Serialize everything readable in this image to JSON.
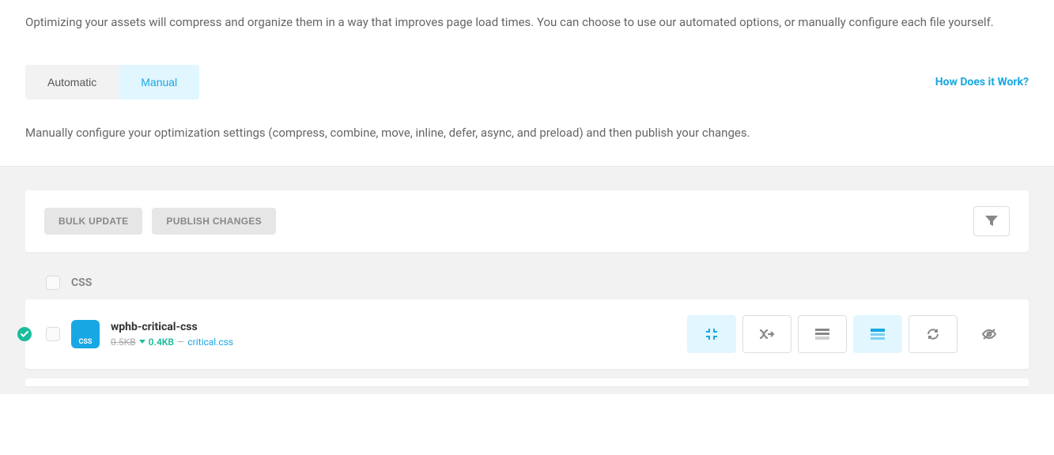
{
  "intro": "Optimizing your assets will compress and organize them in a way that improves page load times. You can choose to use our automated options, or manually configure each file yourself.",
  "tabs": {
    "automatic": "Automatic",
    "manual": "Manual"
  },
  "help_link": "How Does it Work?",
  "sub_desc": "Manually configure your optimization settings (compress, combine, move, inline, defer, async, and preload) and then publish your changes.",
  "buttons": {
    "bulk_update": "BULK UPDATE",
    "publish": "PUBLISH CHANGES"
  },
  "group": {
    "label": "CSS"
  },
  "asset": {
    "name": "wphb-critical-css",
    "badge": "CSS",
    "size_orig": "0.5KB",
    "size_new": "0.4KB",
    "sep": " — ",
    "file": "critical.css"
  }
}
